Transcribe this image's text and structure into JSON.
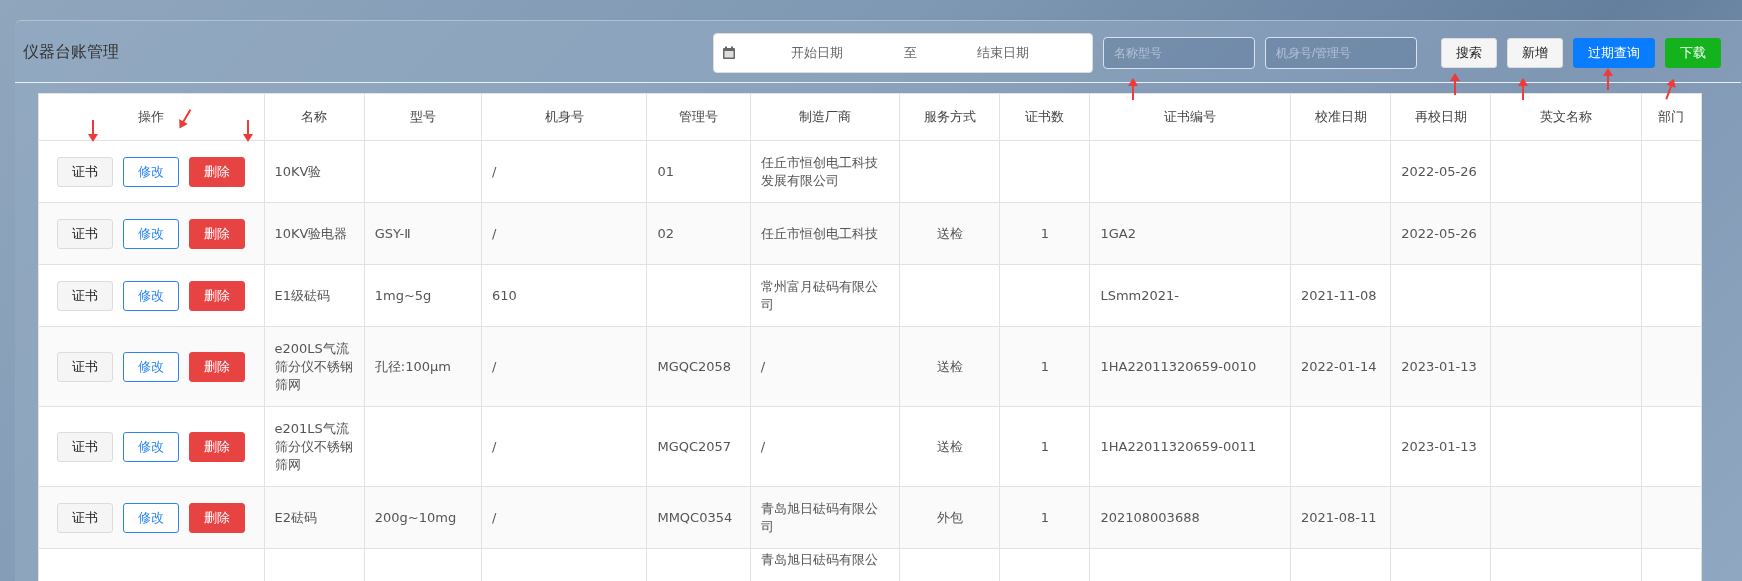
{
  "title": "仪器台账管理",
  "filters": {
    "start_date": {
      "placeholder": "开始日期"
    },
    "separator": "至",
    "end_date": {
      "placeholder": "结束日期"
    },
    "name_model": {
      "placeholder": "名称型号"
    },
    "serial_mgmt": {
      "placeholder": "机身号/管理号"
    }
  },
  "buttons": [
    {
      "label": "搜索",
      "kind": "plain"
    },
    {
      "label": "新增",
      "kind": "plain"
    },
    {
      "label": "过期查询",
      "kind": "primary"
    },
    {
      "label": "下载",
      "kind": "success"
    }
  ],
  "table": {
    "columns": [
      "操作",
      "名称",
      "型号",
      "机身号",
      "管理号",
      "制造厂商",
      "服务方式",
      "证书数",
      "证书编号",
      "校准日期",
      "再校日期",
      "英文名称",
      "部门"
    ],
    "rows": [
      {
        "cells": [
          {
            "buttons": [
              {
                "label": "证书",
                "kind": "plain"
              },
              {
                "label": "修改",
                "kind": "outline"
              },
              {
                "label": "删除",
                "kind": "danger"
              }
            ]
          },
          "10KV验",
          "",
          "/",
          "01",
          "任丘市恒创电工科技发展有限公司",
          "",
          "",
          "",
          "",
          "2022-05-26",
          "",
          ""
        ]
      },
      {
        "cells": [
          {
            "buttons": [
              {
                "label": "证书",
                "kind": "plain"
              },
              {
                "label": "修改",
                "kind": "outline"
              },
              {
                "label": "删除",
                "kind": "danger"
              }
            ]
          },
          "10KV验电器",
          "GSY-Ⅱ",
          "/",
          "02",
          "任丘市恒创电工科技",
          "送检",
          "1",
          "1GA2",
          "",
          "2022-05-26",
          "",
          ""
        ]
      },
      {
        "cells": [
          {
            "buttons": [
              {
                "label": "证书",
                "kind": "plain"
              },
              {
                "label": "修改",
                "kind": "outline"
              },
              {
                "label": "删除",
                "kind": "danger"
              }
            ]
          },
          "E1级砝码",
          "1mg~5g",
          "610",
          "",
          "常州富月砝码有限公司",
          "",
          "",
          "LSmm2021-",
          "2021-11-08",
          "",
          "",
          ""
        ]
      },
      {
        "cells": [
          {
            "buttons": [
              {
                "label": "证书",
                "kind": "plain"
              },
              {
                "label": "修改",
                "kind": "outline"
              },
              {
                "label": "删除",
                "kind": "danger"
              }
            ]
          },
          "e200LS气流筛分仪不锈钢筛网",
          "孔径:100μm",
          "/",
          "MGQC2058",
          "/",
          "送检",
          "1",
          "1HA22011320659-0010",
          "2022-01-14",
          "2023-01-13",
          "",
          ""
        ]
      },
      {
        "cells": [
          {
            "buttons": [
              {
                "label": "证书",
                "kind": "plain"
              },
              {
                "label": "修改",
                "kind": "outline"
              },
              {
                "label": "删除",
                "kind": "danger"
              }
            ]
          },
          "e201LS气流筛分仪不锈钢筛网",
          "",
          "/",
          "MGQC2057",
          "/",
          "送检",
          "1",
          "1HA22011320659-0011",
          "",
          "2023-01-13",
          "",
          ""
        ]
      },
      {
        "cells": [
          {
            "buttons": [
              {
                "label": "证书",
                "kind": "plain"
              },
              {
                "label": "修改",
                "kind": "outline"
              },
              {
                "label": "删除",
                "kind": "danger"
              }
            ]
          },
          "E2砝码",
          "200g~10mg",
          "/",
          "MMQC0354",
          "青岛旭日砝码有限公司",
          "外包",
          "1",
          "202108003688",
          "2021-08-11",
          "",
          "",
          ""
        ]
      },
      {
        "cells": [
          "",
          "",
          "",
          "",
          "",
          "青岛旭日砝码有限公",
          "",
          "",
          "",
          "",
          "",
          "",
          ""
        ]
      }
    ]
  }
}
